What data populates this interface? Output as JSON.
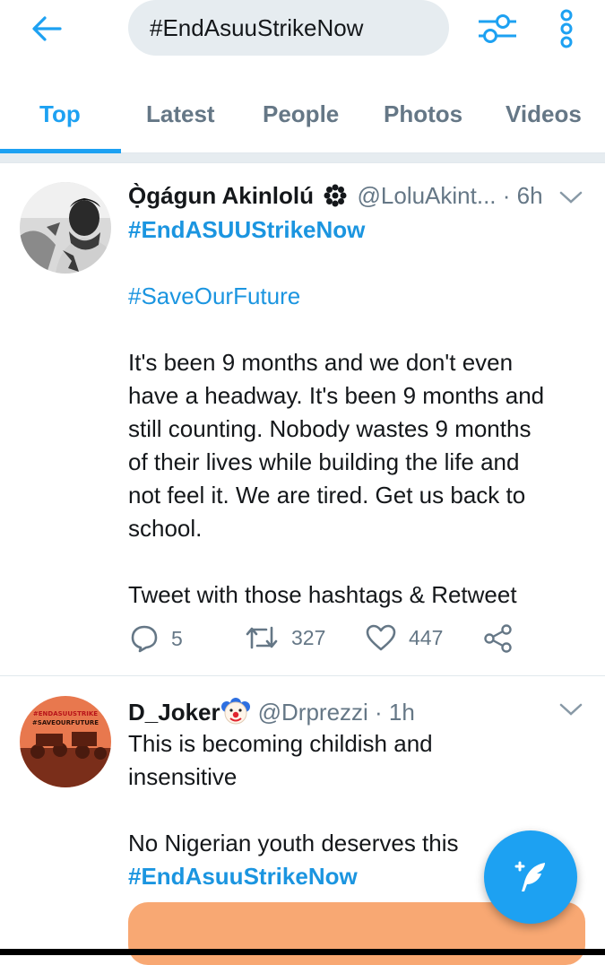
{
  "search": {
    "query": "#EndAsuuStrikeNow"
  },
  "tabs": [
    {
      "label": "Top",
      "active": true
    },
    {
      "label": "Latest",
      "active": false
    },
    {
      "label": "People",
      "active": false
    },
    {
      "label": "Photos",
      "active": false
    },
    {
      "label": "Videos",
      "active": false
    }
  ],
  "colors": {
    "accent": "#1da1f2",
    "text": "#14171a",
    "muted": "#657786",
    "media": "#f8a873"
  },
  "tweets": [
    {
      "name": "Ọ̀gágun Akinlolú",
      "badge": "sunflower-badge-icon",
      "handle": "@LoluAkint...",
      "time": "· 6h",
      "hashtag1": "#EndASUUStrikeNow",
      "hashtag2": "#SaveOurFuture",
      "lines": [
        "It's been 9 months and we don't even",
        "have a headway. It's been 9 months and",
        "still counting. Nobody wastes 9 months",
        "of their lives while building the life and",
        "not feel it. We are tired. Get us back to",
        "school."
      ],
      "closing": "Tweet with those hashtags & Retweet",
      "replies": "5",
      "retweets": "327",
      "likes": "447"
    },
    {
      "name": "D_Joker",
      "badge": "clown-face-icon",
      "handle": "@Drprezzi",
      "time": "· 1h",
      "lines": [
        "This is becoming childish and",
        "insensitive"
      ],
      "line3": "No Nigerian youth deserves this",
      "hashtag": "#EndAsuuStrikeNow",
      "avatar_text": [
        "#ENDASUUSTRIKE",
        "#SAVEOURFUTURE"
      ]
    }
  ]
}
